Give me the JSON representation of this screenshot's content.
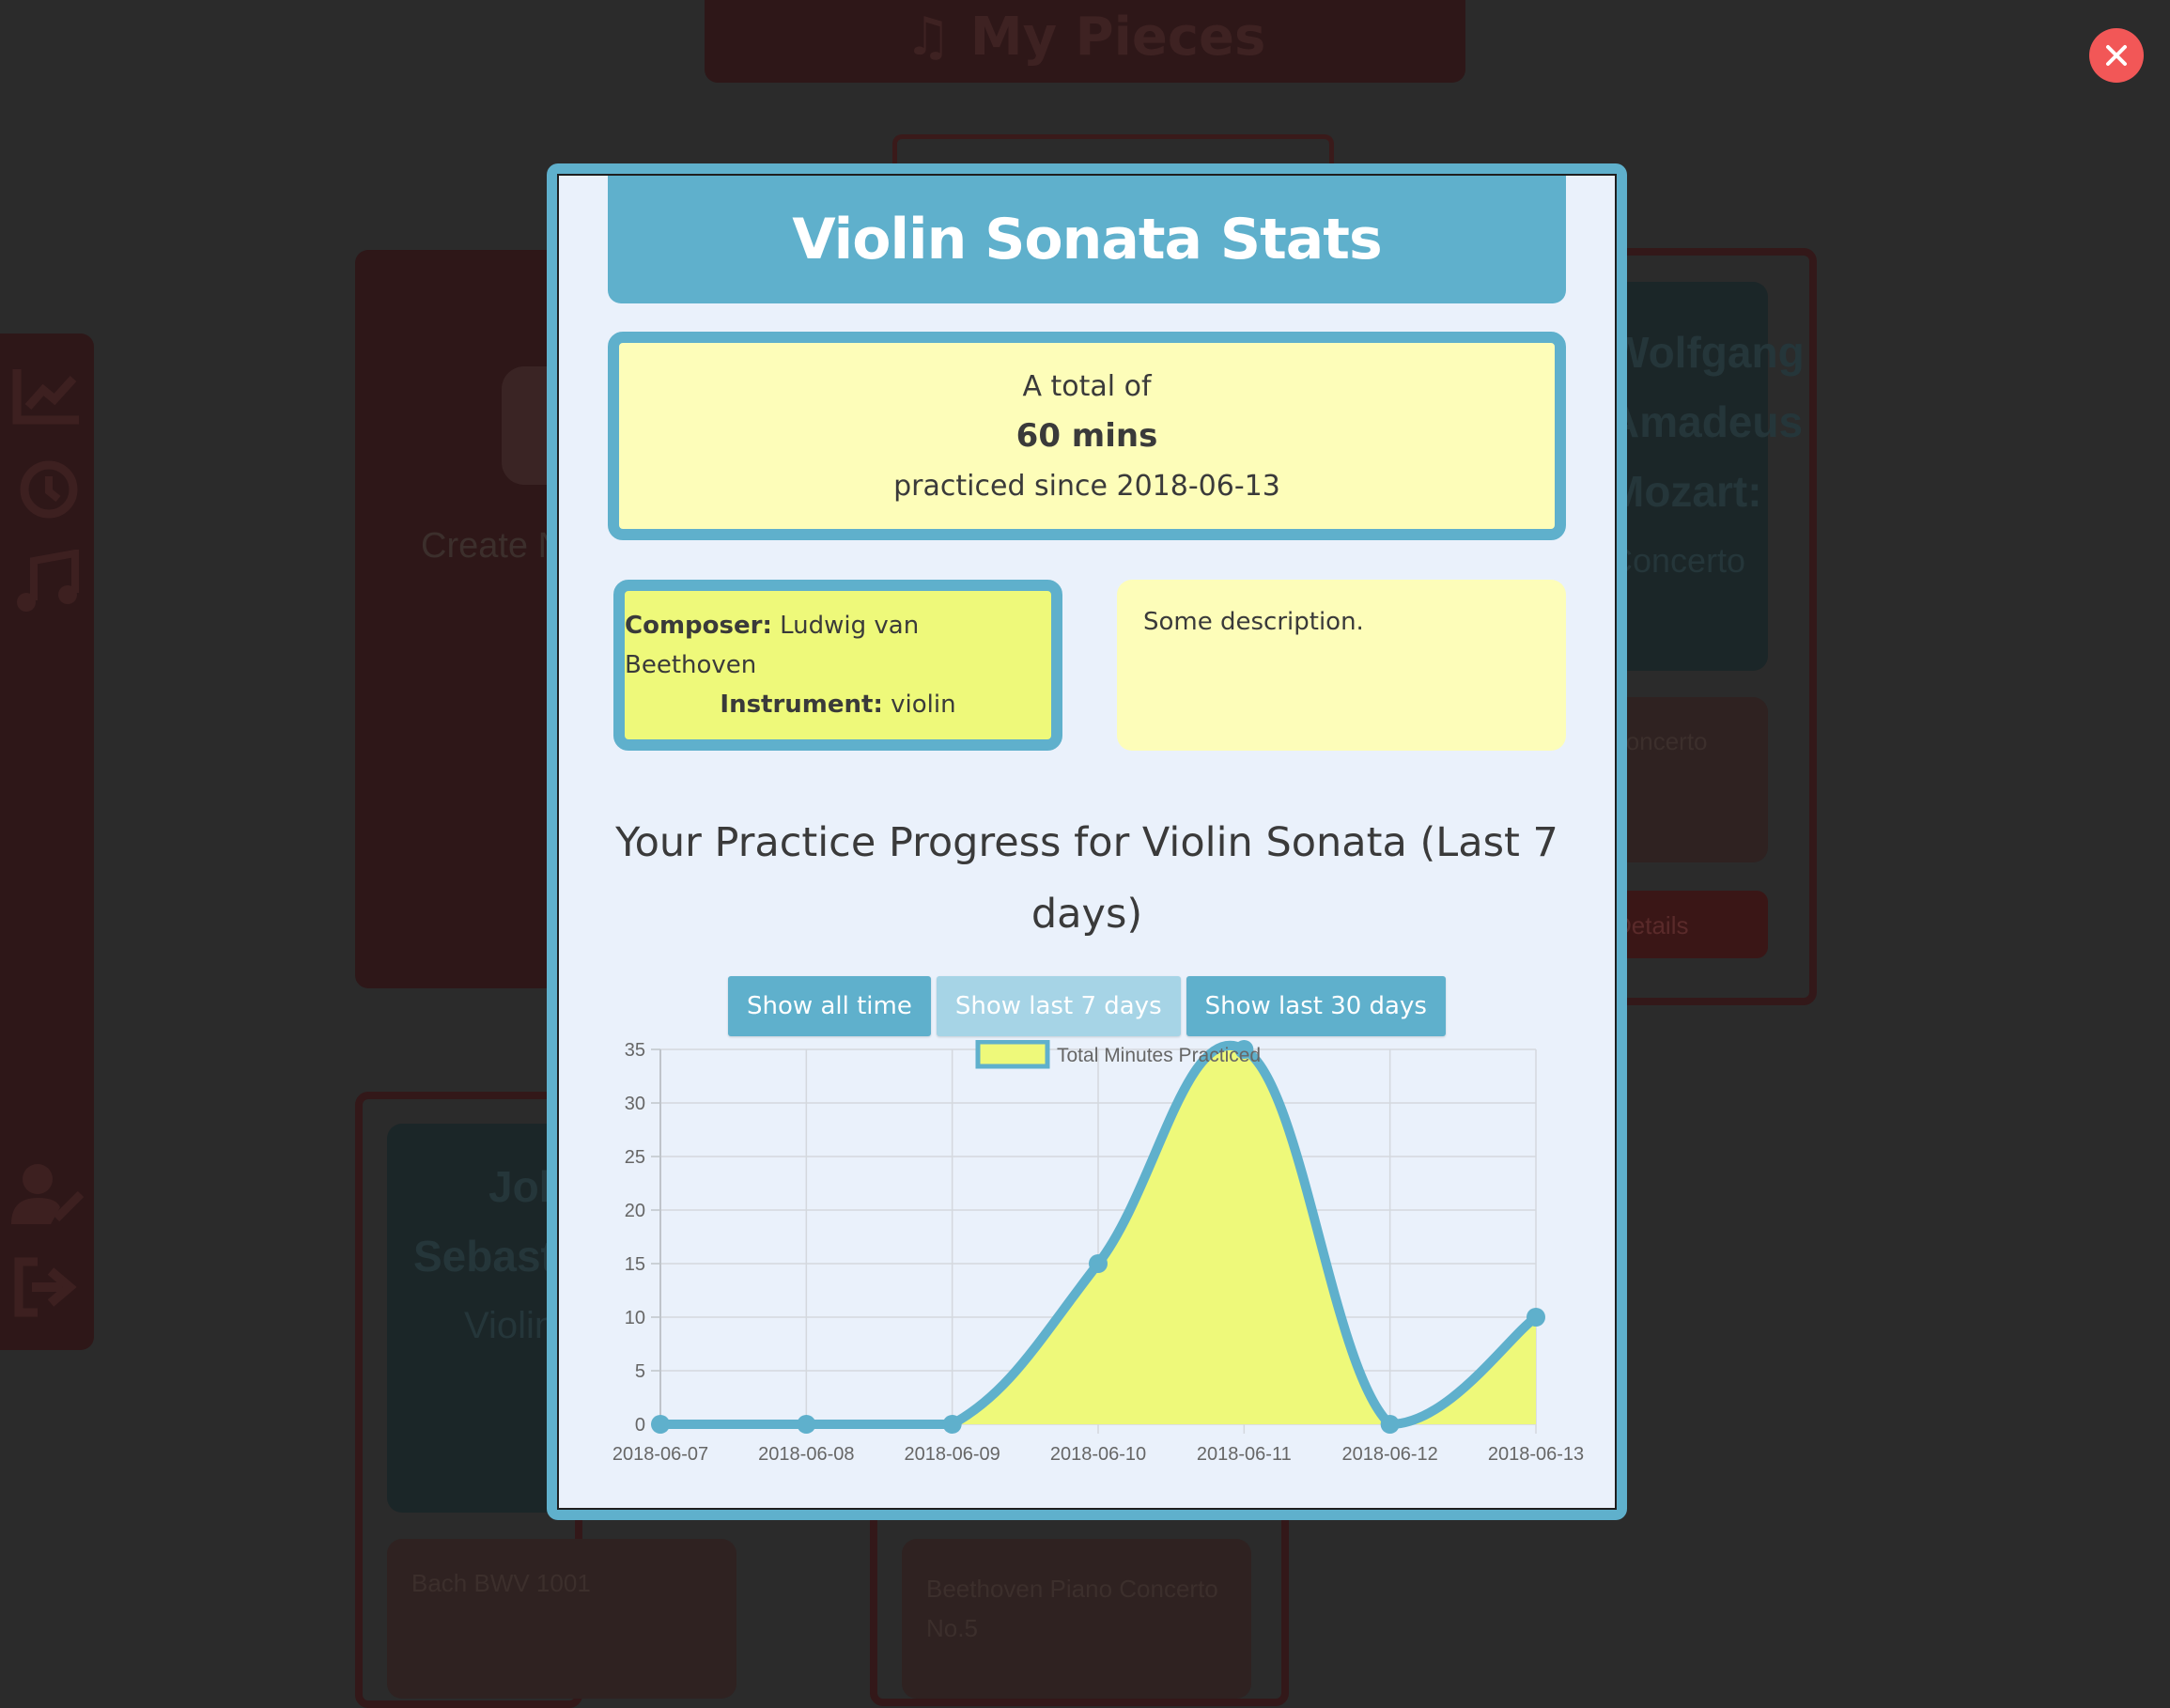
{
  "background": {
    "header_title": "My Pieces",
    "create_label": "Create New",
    "side_card_lines": [
      "Wolfgang",
      "Amadeus",
      "Mozart:",
      "Concerto"
    ],
    "side_card_item": "Concerto",
    "side_card_button": "Details",
    "bottom_left_card_lines": [
      "Johann",
      "Sebastian",
      "Violin"
    ],
    "bottom_left_item": "Bach BWV 1001",
    "bottom_mid_item": "Beethoven Piano Concerto No.5"
  },
  "close_button": {
    "icon": "close-icon"
  },
  "modal": {
    "title": "Violin Sonata Stats",
    "total": {
      "prefix": "A total of",
      "minutes": "60 mins",
      "since": "practiced since 2018-06-13"
    },
    "info": {
      "composer_label": "Composer:",
      "composer": "Ludwig van Beethoven",
      "instrument_label": "Instrument:",
      "instrument": "violin"
    },
    "description": "Some description.",
    "progress_title": "Your Practice Progress for Violin Sonata (Last 7 days)",
    "range_buttons": [
      {
        "label": "Show all time",
        "active": false
      },
      {
        "label": "Show last 7 days",
        "active": true
      },
      {
        "label": "Show last 30 days",
        "active": false
      }
    ]
  },
  "colors": {
    "accent": "#5fb0cc",
    "fill_yellow": "#eef97a",
    "close_red": "#f25757"
  },
  "chart_data": {
    "type": "area",
    "x": [
      "2018-06-07",
      "2018-06-08",
      "2018-06-09",
      "2018-06-10",
      "2018-06-11",
      "2018-06-12",
      "2018-06-13"
    ],
    "series": [
      {
        "name": "Total Minutes Practiced",
        "values": [
          0,
          0,
          0,
          15,
          35,
          0,
          10
        ]
      }
    ],
    "ylim": [
      0,
      35
    ],
    "yticks": [
      0,
      5,
      10,
      15,
      20,
      25,
      30,
      35
    ],
    "grid": true,
    "legend": "top-center",
    "title": "",
    "xlabel": "",
    "ylabel": ""
  }
}
